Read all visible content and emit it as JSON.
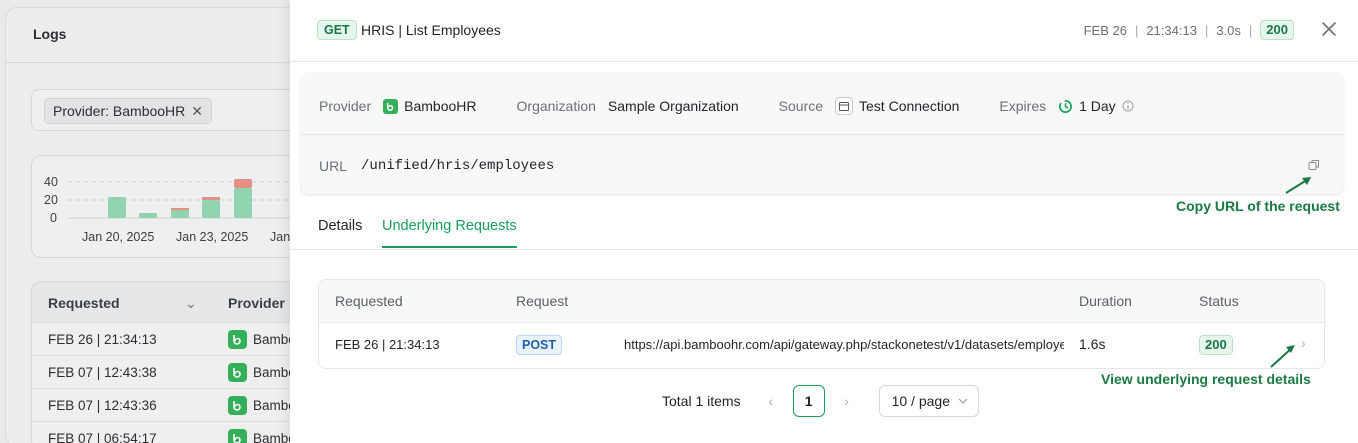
{
  "background": {
    "title": "Logs",
    "filter_chip": "Provider: BambooHR",
    "chart": {
      "y_ticks": [
        "40",
        "20",
        "0"
      ],
      "x_ticks": [
        "Jan 20, 2025",
        "Jan 23, 2025",
        "Jan"
      ]
    },
    "table": {
      "col_requested": "Requested",
      "col_provider": "Provider",
      "rows": [
        {
          "date": "FEB 26 | 21:34:13",
          "provider": "Bamboo"
        },
        {
          "date": "FEB 07 | 12:43:38",
          "provider": "Bamboo"
        },
        {
          "date": "FEB 07 | 12:43:36",
          "provider": "Bamboo"
        },
        {
          "date": "FEB 07 | 06:54:17",
          "provider": "Bamboo"
        }
      ]
    }
  },
  "drawer": {
    "method": "GET",
    "title": "HRIS | List Employees",
    "date": "FEB 26",
    "time": "21:34:13",
    "duration": "3.0s",
    "status": "200",
    "info": {
      "provider_label": "Provider",
      "provider_value": "BambooHR",
      "org_label": "Organization",
      "org_value": "Sample Organization",
      "source_label": "Source",
      "source_value": "Test Connection",
      "expires_label": "Expires",
      "expires_value": "1 Day",
      "url_label": "URL",
      "url_value": "/unified/hris/employees"
    },
    "tabs": [
      {
        "label": "Details",
        "active": false
      },
      {
        "label": "Underlying Requests",
        "active": true
      }
    ],
    "requests_table": {
      "headers": {
        "requested": "Requested",
        "request": "Request",
        "duration": "Duration",
        "status": "Status"
      },
      "rows": [
        {
          "requested": "FEB 26 | 21:34:13",
          "method": "POST",
          "url": "https://api.bamboohr.com/api/gateway.php/stackonetest/v1/datasets/employee",
          "duration": "1.6s",
          "status": "200"
        }
      ]
    },
    "pagination": {
      "total": "Total 1 items",
      "current_page": "1",
      "page_size": "10 / page"
    }
  },
  "annotations": {
    "copy_url": "Copy URL of the request",
    "view_details": "View underlying request details"
  },
  "colors": {
    "accent": "#17a05a",
    "annotation": "#1a7a43",
    "bamboo": "#34b05a",
    "chart_bar": "#8fd3b0",
    "chart_error": "#e58f86"
  }
}
